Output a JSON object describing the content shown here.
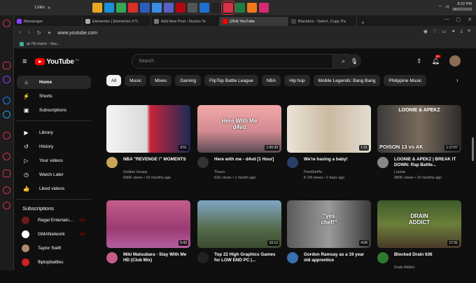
{
  "taskbar": {
    "links_label": "Links",
    "apps": [
      {
        "name": "folder-app",
        "color": "#e8a825"
      },
      {
        "name": "edge-app",
        "color": "#1b8fd8"
      },
      {
        "name": "chrome-app",
        "color": "#35a853"
      },
      {
        "name": "pdf-app",
        "color": "#d9302c"
      },
      {
        "name": "word-app",
        "color": "#2b5dbf"
      },
      {
        "name": "photos-app",
        "color": "#3a8ee6"
      },
      {
        "name": "teams-app",
        "color": "#5b5fc7"
      },
      {
        "name": "netflix-app",
        "color": "#b20710"
      },
      {
        "name": "media-app",
        "color": "#555555"
      },
      {
        "name": "remote-app",
        "color": "#1f6fd0"
      },
      {
        "name": "terminal-app",
        "color": "#222222"
      },
      {
        "name": "opera-app",
        "color": "#d6304a"
      },
      {
        "name": "excel-app",
        "color": "#1e7e45"
      },
      {
        "name": "xampp-app",
        "color": "#f07a18"
      },
      {
        "name": "vpn-app",
        "color": "#d52a74"
      }
    ],
    "time": "8:22 PM",
    "date": "08/02/2023"
  },
  "browser": {
    "tabs": [
      {
        "title": "Messenger",
        "color": "#8a3ffc"
      },
      {
        "title": "Elementor | Elementor #71",
        "color": "#aaaaaa"
      },
      {
        "title": "Add New Post ‹ Nucleo Te",
        "color": "#777777"
      },
      {
        "title": "(254) YouTube",
        "color": "#ff0000"
      },
      {
        "title": "Blackbox - Select, Copy, Pa",
        "color": "#444444"
      }
    ],
    "url": "www.youtube.com",
    "bookmark": "qt-7th-batch - Nuc..."
  },
  "youtube": {
    "logo_text": "YouTube",
    "logo_region": "PH",
    "search_placeholder": "Search",
    "notification_count": "9+",
    "sidebar": {
      "main": [
        {
          "label": "Home",
          "icon": "home-icon",
          "glyph": "⌂"
        },
        {
          "label": "Shorts",
          "icon": "shorts-icon",
          "glyph": "⚡"
        },
        {
          "label": "Subscriptions",
          "icon": "subscriptions-icon",
          "glyph": "▣"
        }
      ],
      "library": [
        {
          "label": "Library",
          "icon": "library-icon",
          "glyph": "▶"
        },
        {
          "label": "History",
          "icon": "history-icon",
          "glyph": "↺"
        },
        {
          "label": "Your videos",
          "icon": "your-videos-icon",
          "glyph": "▷"
        },
        {
          "label": "Watch Later",
          "icon": "watch-later-icon",
          "glyph": "◷"
        },
        {
          "label": "Liked videos",
          "icon": "liked-videos-icon",
          "glyph": "👍"
        }
      ],
      "subscriptions_title": "Subscriptions",
      "subscriptions": [
        {
          "label": "Regal Entertain...",
          "color": "#6a1b1b",
          "live": true
        },
        {
          "label": "GMANetwork",
          "color": "#ffffff",
          "live": true
        },
        {
          "label": "Taylor Swift",
          "color": "#b08870",
          "live": false
        },
        {
          "label": "fliptopbattles",
          "color": "#cc2222",
          "live": false
        }
      ]
    },
    "chips": [
      "All",
      "Music",
      "Mixes",
      "Gaming",
      "FlipTop Battle League",
      "NBA",
      "Hip hop",
      "Mobile Legends: Bang Bang",
      "Philippine Music"
    ],
    "videos": [
      {
        "title": "NBA \"REVENGE !\" MOMENTS",
        "channel": "Golden Hoops",
        "stats": "696K views • 10 months ago",
        "duration": "9:51",
        "thumb_bg": "linear-gradient(90deg,#f4f4f4 0%,#d9d9d9 48%,#c8243b 52%,#1c2a55 100%)",
        "avatar": "#caa35a"
      },
      {
        "title": "Here with me - d4vd [1 Hour]",
        "channel": "Thunn",
        "stats": "61K views • 1 month ago",
        "duration": "1:00:39",
        "thumb_bg": "linear-gradient(180deg,#f2a8a8 0%,#d28b91 55%,#5a4a55 100%)",
        "avatar": "#333333",
        "overlay_text": "Here With Me\nd4vd"
      },
      {
        "title": "We're having a baby!",
        "channel": "PewDiePie",
        "stats": "8.1M views • 2 days ago",
        "duration": "1:31",
        "thumb_bg": "linear-gradient(90deg,#e9e3d8 0%,#cbb9a0 50%,#e3dcd2 100%)",
        "avatar": "#2b3e67"
      },
      {
        "title": "LOONIE & APEKZ | BREAK IT DOWN: Rap Battle...",
        "channel": "Loonie",
        "stats": "985K views • 10 months ago",
        "duration": "1:17:07",
        "thumb_bg": "linear-gradient(90deg,#3a3a3a 0%,#7a6b5c 50%,#2b2b2b 100%)",
        "avatar": "#888888",
        "overlay_top": "LOONIE & APEKZ",
        "overlay_bottom": "POISON 13 vs AK"
      },
      {
        "title": "Miki Matsubara - Stay With Me HD (Club Mix)",
        "channel": "",
        "stats": "",
        "duration": "5:43",
        "thumb_bg": "linear-gradient(180deg,#c45d8a 0%,#9b3b73 60%,#b45fa0 100%)",
        "avatar": "#c45d8a"
      },
      {
        "title": "Top 22 High Graphics Games for LOW END PC |...",
        "channel": "",
        "stats": "",
        "duration": "10:12",
        "thumb_bg": "linear-gradient(180deg,#7fa6c4 0%,#556a4a 60%,#3a4a30 100%)",
        "avatar": "#222222"
      },
      {
        "title": "Gordon Ramsay as a 19 year old apprentice",
        "channel": "",
        "stats": "",
        "duration": "4:06",
        "thumb_bg": "linear-gradient(90deg,#5a5a5a 0%,#9a9a9a 50%,#3a3a3a 100%)",
        "avatar": "#3a6fb0",
        "overlay_text": "\"yes\nchef!\""
      },
      {
        "title": "Blocked Drain 636",
        "channel": "Drain Addict",
        "stats": "",
        "duration": "17:31",
        "thumb_bg": "linear-gradient(180deg,#3d5a2a 0%,#6b7f3a 50%,#4a3a2a 100%)",
        "avatar": "#2f7a2f",
        "overlay_text": "DRAIN\nADDICT"
      }
    ]
  }
}
